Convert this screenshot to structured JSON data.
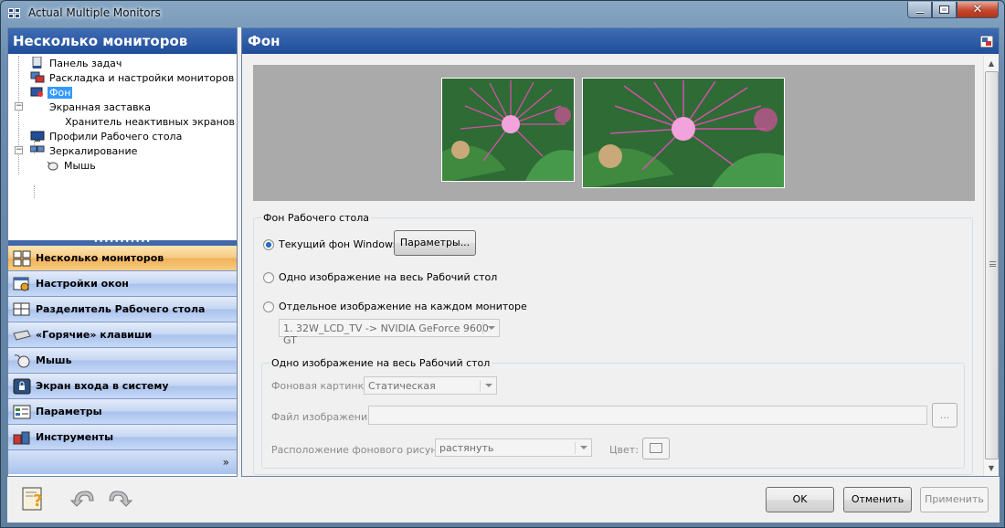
{
  "window": {
    "title": "Actual Multiple Monitors"
  },
  "left": {
    "header": "Несколько мониторов",
    "tree": [
      {
        "label": "Панель задач",
        "icon": "taskbar-icon"
      },
      {
        "label": "Раскладка и настройки мониторов",
        "icon": "monitor-layout-icon"
      },
      {
        "label": "Фон",
        "icon": "wallpaper-icon",
        "selected": true
      },
      {
        "label": "Экранная заставка",
        "icon": "screensaver-icon"
      },
      {
        "label": "Хранитель неактивных экранов",
        "icon": "inactive-screen-icon"
      },
      {
        "label": "Профили Рабочего стола",
        "icon": "desktop-profiles-icon"
      },
      {
        "label": "Зеркалирование",
        "icon": "mirroring-icon"
      },
      {
        "label": "Мышь",
        "icon": "mouse-icon"
      }
    ],
    "nav": [
      {
        "label": "Несколько мониторов",
        "icon": "multiple-monitors-icon",
        "active": true
      },
      {
        "label": "Настройки окон",
        "icon": "window-settings-icon"
      },
      {
        "label": "Разделитель Рабочего стола",
        "icon": "desktop-divider-icon"
      },
      {
        "label": "«Горячие» клавиши",
        "icon": "hotkeys-icon"
      },
      {
        "label": "Мышь",
        "icon": "mouse-icon"
      },
      {
        "label": "Экран входа в систему",
        "icon": "login-screen-icon"
      },
      {
        "label": "Параметры",
        "icon": "options-icon"
      },
      {
        "label": "Инструменты",
        "icon": "tools-icon"
      }
    ],
    "more": "»"
  },
  "right": {
    "header": "Фон",
    "group1": {
      "title": "Фон Рабочего стола",
      "opt_current": "Текущий фон Windows",
      "params_btn": "Параметры...",
      "opt_single": "Одно изображение на весь Рабочий стол",
      "opt_each": "Отдельное изображение на каждом мониторе",
      "monitor_select": "1. 32W_LCD_TV -> NVIDIA GeForce 9600 GT"
    },
    "group2": {
      "title": "Одно изображение на весь Рабочий стол",
      "bg_label": "Фоновая картинка",
      "bg_value": "Статическая",
      "file_label": "Файл изображения:",
      "file_value": "",
      "browse": "...",
      "position_label": "Расположение фонового рисунка:",
      "position_value": "растянуть",
      "color_label": "Цвет:"
    }
  },
  "buttons": {
    "ok": "OK",
    "cancel": "Отменить",
    "apply": "Применить"
  },
  "colors": {
    "header_blue": "#1f4d99",
    "active_nav": "#f7c983",
    "nav_blue": "#c4d5f2",
    "selection": "#3399ff"
  }
}
